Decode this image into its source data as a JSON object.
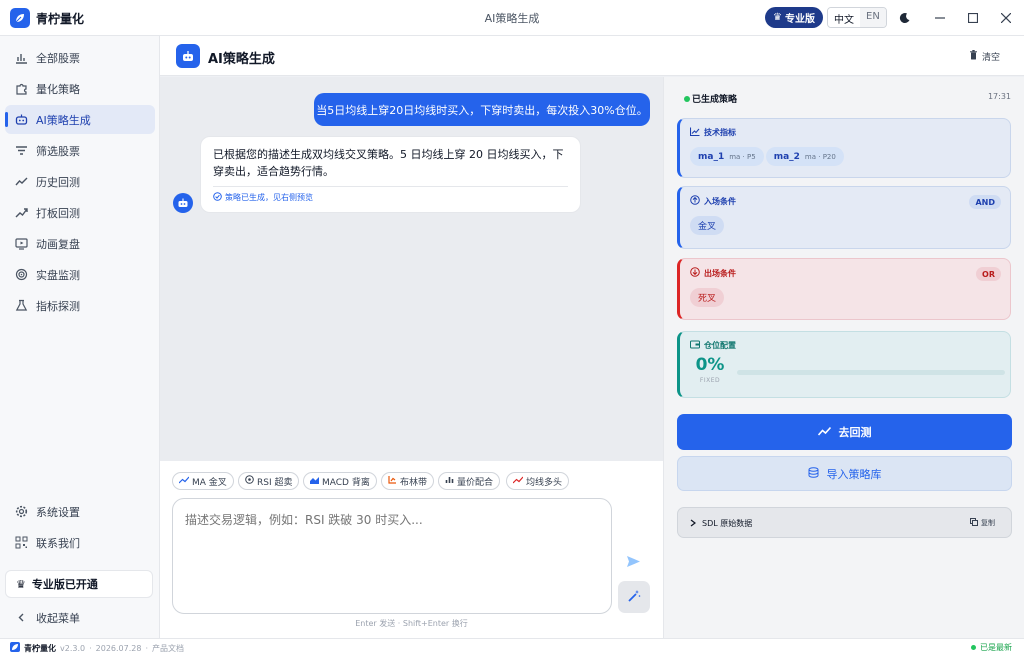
{
  "titlebar": {
    "app_name": "青柠量化",
    "window_title": "AI策略生成",
    "pro_badge": "专业版",
    "lang_zh": "中文",
    "lang_en": "EN",
    "icons": [
      "leaf-icon",
      "crown-icon",
      "moon-icon",
      "minimize-icon",
      "maximize-icon",
      "close-icon"
    ]
  },
  "sidebar": {
    "items": [
      {
        "label": "全部股票",
        "icon": "bar-chart-icon"
      },
      {
        "label": "量化策略",
        "icon": "puzzle-icon"
      },
      {
        "label": "AI策略生成",
        "icon": "robot-icon",
        "active": true
      },
      {
        "label": "筛选股票",
        "icon": "filter-icon"
      },
      {
        "label": "历史回测",
        "icon": "trend-icon"
      },
      {
        "label": "打板回测",
        "icon": "trend-up-icon"
      },
      {
        "label": "动画复盘",
        "icon": "play-screen-icon"
      },
      {
        "label": "实盘监测",
        "icon": "radar-icon"
      },
      {
        "label": "指标探测",
        "icon": "flask-icon"
      }
    ],
    "bottom_items": [
      {
        "label": "系统设置",
        "icon": "gear-icon"
      },
      {
        "label": "联系我们",
        "icon": "qr-code-icon"
      }
    ],
    "pro_status": "专业版已开通",
    "collapse_label": "收起菜单"
  },
  "main": {
    "title": "AI策略生成",
    "clear_label": "清空"
  },
  "chat": {
    "user_message": "当5日均线上穿20日均线时买入，下穿时卖出，每次投入30%仓位。",
    "bot_message": "已根据您的描述生成双均线交叉策略。5 日均线上穿 20 日均线买入，下穿卖出，适合趋势行情。",
    "bot_status": "策略已生成，见右侧预览"
  },
  "composer": {
    "chips": [
      {
        "label": "MA 金叉",
        "icon": "trend-icon",
        "color": "#2563eb"
      },
      {
        "label": "RSI 超卖",
        "icon": "target-icon",
        "color": "#374151"
      },
      {
        "label": "MACD 背离",
        "icon": "area-chart-icon",
        "color": "#2563eb"
      },
      {
        "label": "布林带",
        "icon": "bollinger-icon",
        "color": "#ea580c"
      },
      {
        "label": "量价配合",
        "icon": "bar-chart-icon",
        "color": "#374151"
      },
      {
        "label": "均线多头",
        "icon": "trend-up-icon",
        "color": "#dc2626"
      }
    ],
    "placeholder": "描述交易逻辑，例如：RSI 跌破 30 时买入...",
    "hint": "Enter 发送 · Shift+Enter 换行"
  },
  "strategy": {
    "title": "已生成策略",
    "time": "17:31",
    "indicators": {
      "title": "技术指标",
      "items": [
        {
          "name": "ma_1",
          "detail": "ma · P5"
        },
        {
          "name": "ma_2",
          "detail": "ma · P20"
        }
      ]
    },
    "entry": {
      "title": "入场条件",
      "logic": "AND",
      "conditions": [
        "金叉"
      ]
    },
    "exit": {
      "title": "出场条件",
      "logic": "OR",
      "conditions": [
        "死叉"
      ]
    },
    "position": {
      "title": "仓位配置",
      "value": "0%",
      "mode": "FIXED",
      "fraction": 0.0
    },
    "backtest_label": "去回测",
    "import_label": "导入策略库",
    "sdl_label": "SDL 原始数据",
    "copy_label": "复制"
  },
  "statusbar": {
    "app_name": "青柠量化",
    "version": "v2.3.0",
    "date": "2026.07.28",
    "docs": "产品文档",
    "status": "已是最新"
  },
  "colors": {
    "primary": "#2563eb",
    "teal": "#0d9488",
    "danger": "#dc2626",
    "success": "#22c55e"
  }
}
